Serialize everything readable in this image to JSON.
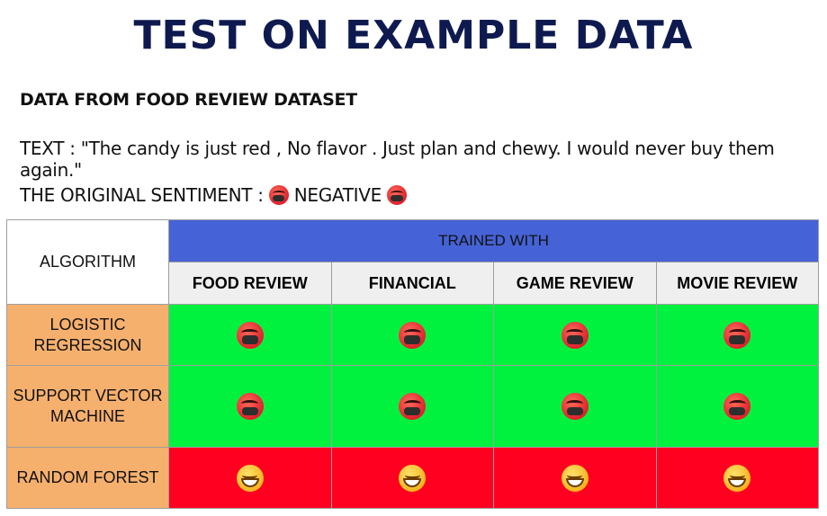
{
  "title": "TEST ON EXAMPLE DATA",
  "subtitle": "DATA FROM FOOD REVIEW DATASET",
  "text_line": "TEXT : \"The candy is just red , No flavor . Just  plan and chewy. I would never buy them again.\"",
  "original_sentiment": {
    "label": "THE ORIGINAL SENTIMENT :",
    "value": "NEGATIVE",
    "icon": "angry-face-icon"
  },
  "table": {
    "algorithm_header": "ALGORITHM",
    "trained_with_header": "TRAINED WITH",
    "columns": [
      "FOOD REVIEW",
      "FINANCIAL",
      "GAME REVIEW",
      "MOVIE REVIEW"
    ],
    "rows": [
      {
        "algorithm": "LOGISTIC REGRESSION",
        "results": [
          "negative",
          "negative",
          "negative",
          "negative"
        ]
      },
      {
        "algorithm": "SUPPORT VECTOR MACHINE",
        "results": [
          "negative",
          "negative",
          "negative",
          "negative"
        ]
      },
      {
        "algorithm": "RANDOM FOREST",
        "results": [
          "positive",
          "positive",
          "positive",
          "positive"
        ]
      }
    ]
  },
  "colors": {
    "title": "#0e1a4f",
    "header_blue": "#4562d6",
    "algorithm_orange": "#f6b06e",
    "correct_green": "#00f23f",
    "wrong_red": "#ff0021"
  }
}
